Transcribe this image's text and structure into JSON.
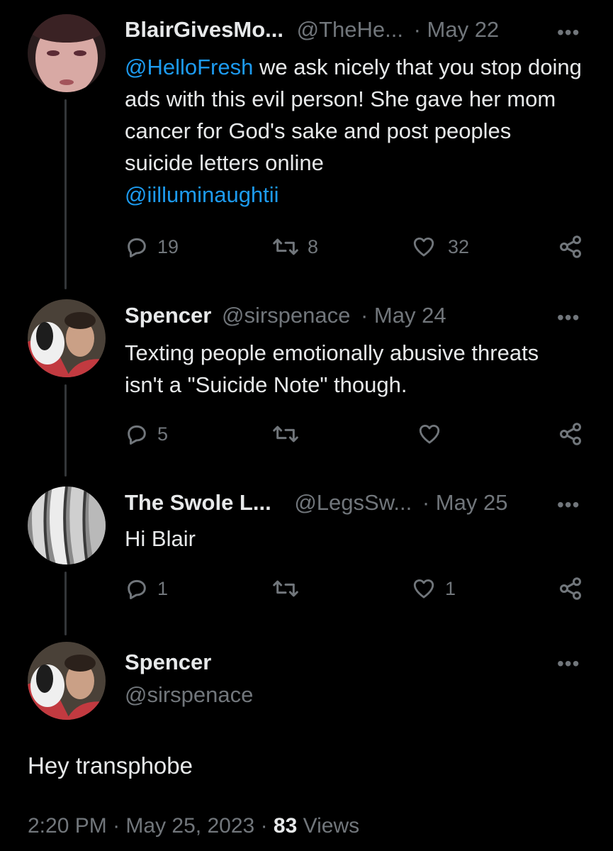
{
  "tweets": [
    {
      "name": "BlairGivesMo...",
      "handle": "@TheHe...",
      "date": "· May 22",
      "text_parts": {
        "mention1": "@HelloFresh",
        "t1": " we ask nicely that you stop doing ads with this evil person! She gave her mom cancer for God's sake and post peoples suicide letters online",
        "mention2": "@iilluminaughtii"
      },
      "replies": "19",
      "retweets": "8",
      "likes": "32"
    },
    {
      "name": "Spencer",
      "handle": "@sirspenace",
      "date": "· May 24",
      "text": "Texting people emotionally abusive threats isn't a \"Suicide Note\" though.",
      "replies": "5",
      "retweets": "",
      "likes": ""
    },
    {
      "name": "The Swole L...",
      "handle": "@LegsSw...",
      "date": "· May 25",
      "text": "Hi Blair",
      "replies": "1",
      "retweets": "",
      "likes": "1"
    }
  ],
  "focus": {
    "name": "Spencer",
    "handle": "@sirspenace",
    "text": "Hey transphobe",
    "time": "2:20 PM",
    "sep1": "·",
    "date": "May 25, 2023",
    "sep2": "·",
    "views_count": "83",
    "views_label": "Views"
  },
  "icons": {
    "reply": "reply-icon",
    "retweet": "retweet-icon",
    "like": "heart-icon",
    "share": "share-icon",
    "more": "more-icon"
  },
  "more_glyph": "•••",
  "colors": {
    "background": "#000000",
    "text": "#e7e9ea",
    "muted": "#71767b",
    "link": "#1d9bf0"
  }
}
